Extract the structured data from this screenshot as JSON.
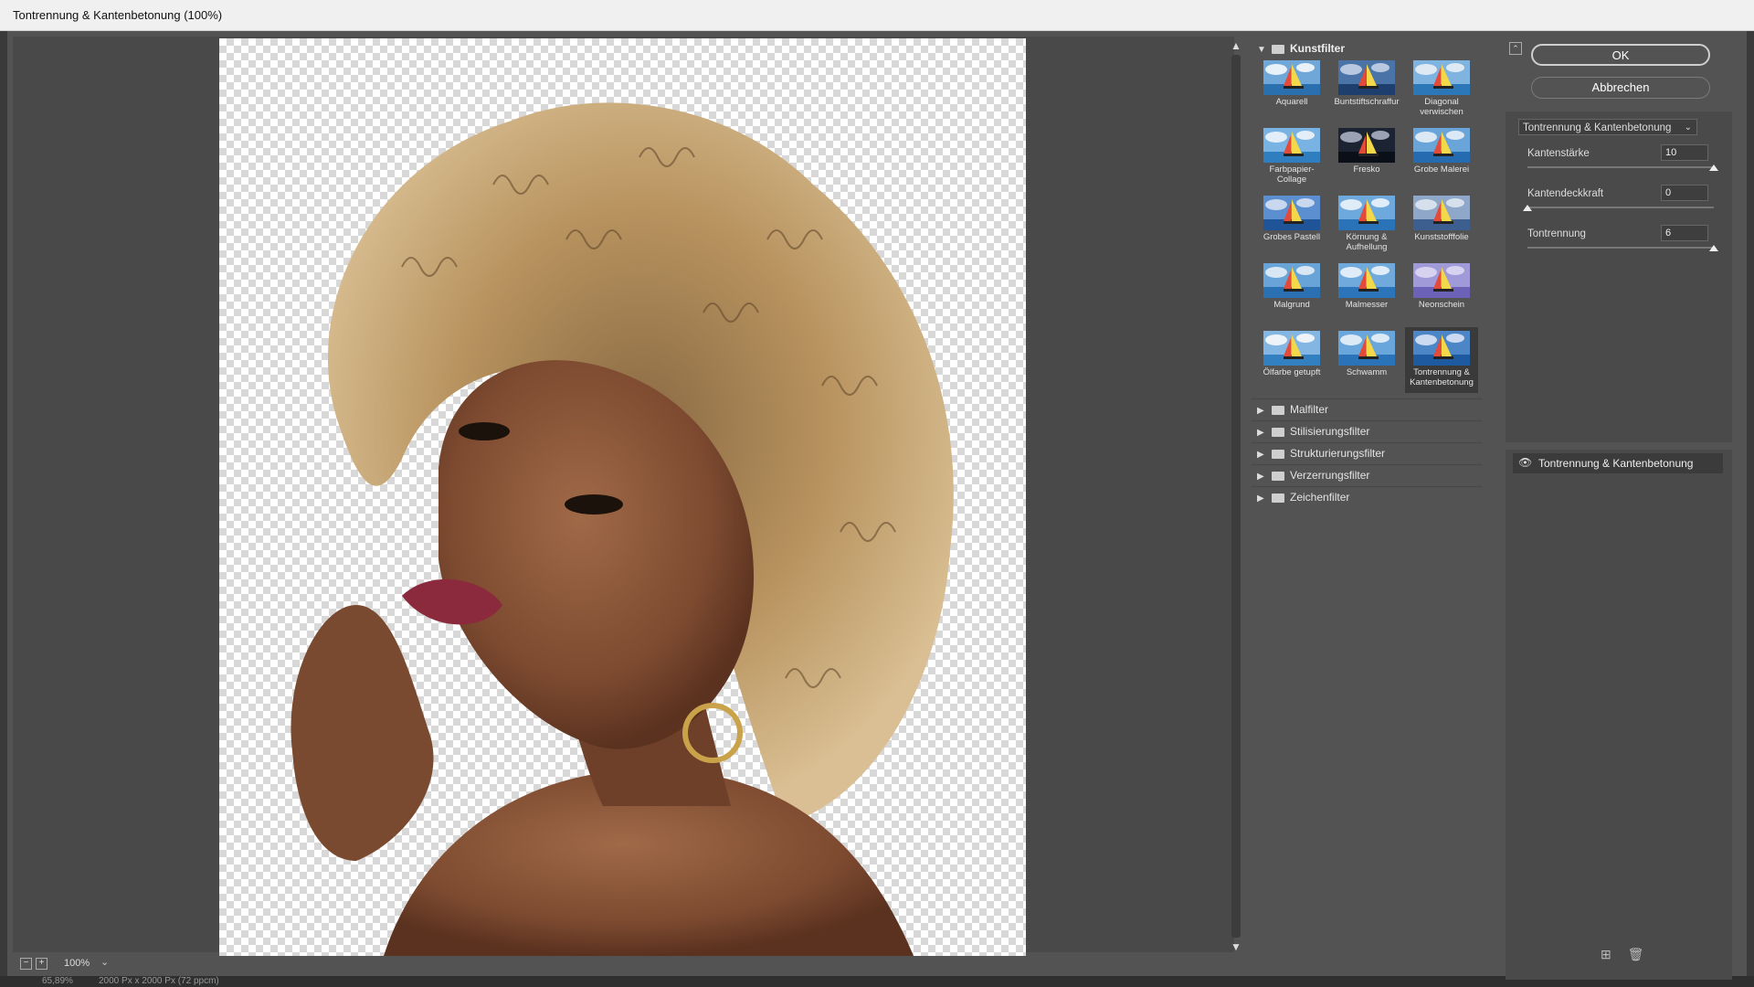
{
  "window": {
    "title": "Tontrennung & Kantenbetonung (100%)"
  },
  "preview": {
    "zoom": "100%",
    "status_zoom": "65,89%",
    "status_size": "2000 Px x 2000 Px (72 ppcm)"
  },
  "gallery": {
    "open_category": "Kunstfilter",
    "thumbnails": [
      {
        "label": "Aquarell",
        "selected": false
      },
      {
        "label": "Buntstiftschraffur",
        "selected": false
      },
      {
        "label": "Diagonal verwischen",
        "selected": false
      },
      {
        "label": "Farbpapier-Collage",
        "selected": false
      },
      {
        "label": "Fresko",
        "selected": false
      },
      {
        "label": "Grobe Malerei",
        "selected": false
      },
      {
        "label": "Grobes Pastell",
        "selected": false
      },
      {
        "label": "Körnung & Aufhellung",
        "selected": false
      },
      {
        "label": "Kunststofffolie",
        "selected": false
      },
      {
        "label": "Malgrund",
        "selected": false
      },
      {
        "label": "Malmesser",
        "selected": false
      },
      {
        "label": "Neonschein",
        "selected": false
      },
      {
        "label": "Ölfarbe getupft",
        "selected": false
      },
      {
        "label": "Schwamm",
        "selected": false
      },
      {
        "label": "Tontrennung & Kantenbetonung",
        "selected": true
      }
    ],
    "categories": [
      "Malfilter",
      "Stilisierungsfilter",
      "Strukturierungsfilter",
      "Verzerrungsfilter",
      "Zeichenfilter"
    ]
  },
  "buttons": {
    "ok": "OK",
    "cancel": "Abbrechen"
  },
  "filter_select": {
    "value": "Tontrennung & Kantenbetonung"
  },
  "params": [
    {
      "name": "Kantenstärke",
      "value": "10",
      "fraction": 1.0
    },
    {
      "name": "Kantendeckkraft",
      "value": "0",
      "fraction": 0.0
    },
    {
      "name": "Tontrennung",
      "value": "6",
      "fraction": 1.0
    }
  ],
  "layers": [
    {
      "name": "Tontrennung & Kantenbetonung"
    }
  ],
  "icons": {
    "collapse": "collapse-icon",
    "eye": "eye-icon",
    "new_layer": "new-effect-layer-icon",
    "delete": "trash-icon",
    "folder": "folder-icon"
  }
}
